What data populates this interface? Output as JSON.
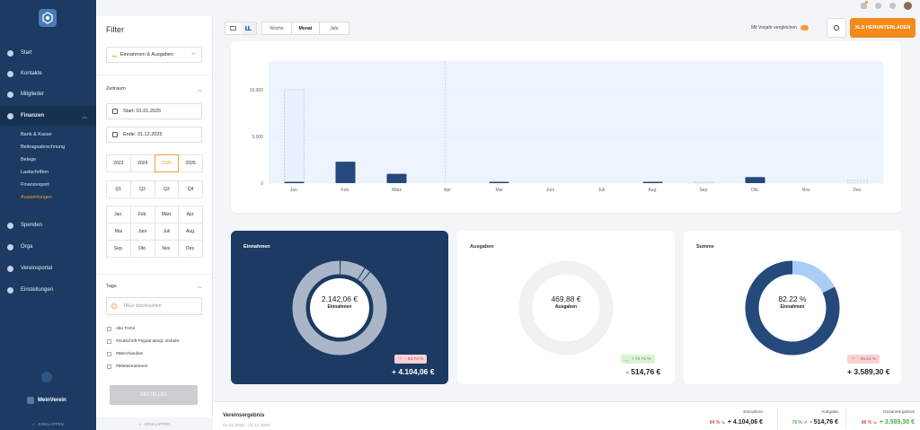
{
  "sidebar": {
    "items": [
      {
        "label": "Start",
        "icon": "dashboard-icon"
      },
      {
        "label": "Kontakte",
        "icon": "contacts-icon"
      },
      {
        "label": "Mitglieder",
        "icon": "members-icon"
      },
      {
        "label": "Finanzen",
        "icon": "bank-icon"
      },
      {
        "label": "Spenden",
        "icon": "donation-icon"
      },
      {
        "label": "Orga",
        "icon": "orga-icon"
      },
      {
        "label": "Vereinsportal",
        "icon": "portal-icon"
      },
      {
        "label": "Einstellungen",
        "icon": "gear-icon"
      }
    ],
    "sub_items": [
      "Bank & Kasse",
      "Beitragsabrechnung",
      "Belege",
      "Lastschriften",
      "Finanzexport",
      "Auswertungen"
    ],
    "org_name": "MeinVerein",
    "collapse_label": "EINKLAPPEN"
  },
  "filter": {
    "title": "Filter",
    "select_value": "Einnahmen & Ausgaben",
    "zeitraum_label": "Zeitraum",
    "start_label": "Start: 01.01.2025",
    "end_label": "Ende: 31.12.2025",
    "years": [
      "2023",
      "2024",
      "2025",
      "2026"
    ],
    "selected_year": "2025",
    "quarters": [
      "Q1",
      "Q2",
      "Q3",
      "Q4"
    ],
    "months": [
      "Jan.",
      "Feb.",
      "März",
      "Apr.",
      "Mai",
      "Juni",
      "Juli",
      "Aug.",
      "Sep.",
      "Okt.",
      "Nov.",
      "Dez."
    ],
    "tags_label": "Tags",
    "tags_placeholder": "TAGs durchsuchen",
    "tags": [
      "Alle TAGs",
      "#Gutschrift Paypal abzgl. Gebühr",
      "#Merchandise",
      "#Mieteinnahmen"
    ],
    "create_label": "ERSTELLEN",
    "collapse_label": "EINKLAPPEN"
  },
  "toolbar": {
    "periods": [
      "Woche",
      "Monat",
      "Jahr"
    ],
    "active_period": "Monat",
    "compare_label": "Mit Vorjahr vergleichen",
    "download_label": "XLS HERUNTERLADEN",
    "accent": "#f28a1c"
  },
  "chart_data": {
    "type": "bar",
    "categories": [
      "Jan.",
      "Feb.",
      "März",
      "Apr.",
      "Mai",
      "Juni",
      "Juli",
      "Aug.",
      "Sep.",
      "Okt.",
      "Nov.",
      "Dez."
    ],
    "yticks": [
      "10.000",
      "5.000",
      "0"
    ],
    "ylim": [
      0,
      10000
    ],
    "series": [
      {
        "values": [
          150,
          2300,
          1000,
          0,
          50,
          0,
          0,
          30,
          0,
          650,
          0,
          0
        ]
      },
      {
        "values": [
          10000,
          0,
          0,
          0,
          0,
          0,
          0,
          0,
          150,
          0,
          0,
          300
        ]
      }
    ],
    "colors": {
      "bar": "#24497a",
      "prev_fill": "#e8f1fc",
      "prev_stroke": "#aebdd0",
      "area": "#edf4fd"
    }
  },
  "kpis": {
    "einnahmen": {
      "title": "Einnahmen",
      "center_value": "2.142,06 €",
      "center_label": "Einnahmen",
      "badge": "- 83,73 %",
      "total": "+ 4.104,06 €"
    },
    "ausgaben": {
      "title": "Ausgaben",
      "center_value": "469,88 €",
      "center_label": "Ausgaben",
      "badge": "+ 78,75 %",
      "total": "- 514,76 €"
    },
    "summe": {
      "title": "Summe",
      "center_value": "82.22 %",
      "center_label": "Einnahmen",
      "badge": "- 85,61 %",
      "total": "+ 3.589,30 €",
      "pie_fraction": 0.8222
    }
  },
  "footer": {
    "title": "Vereinsergebnis",
    "date_range": "01.01.2025 - 31.12.2025",
    "einnahme_label": "Einnahme",
    "einnahme_pct": "84 % ↘",
    "einnahme_value": "+ 4.104,06 €",
    "ausgabe_label": "Ausgabe",
    "ausgabe_pct": "79 % ↗",
    "ausgabe_value": "- 514,76 €",
    "gesamt_label": "Gesamtergebnis",
    "gesamt_pct": "86 % ↘",
    "gesamt_value": "+ 3.589,30 €"
  }
}
